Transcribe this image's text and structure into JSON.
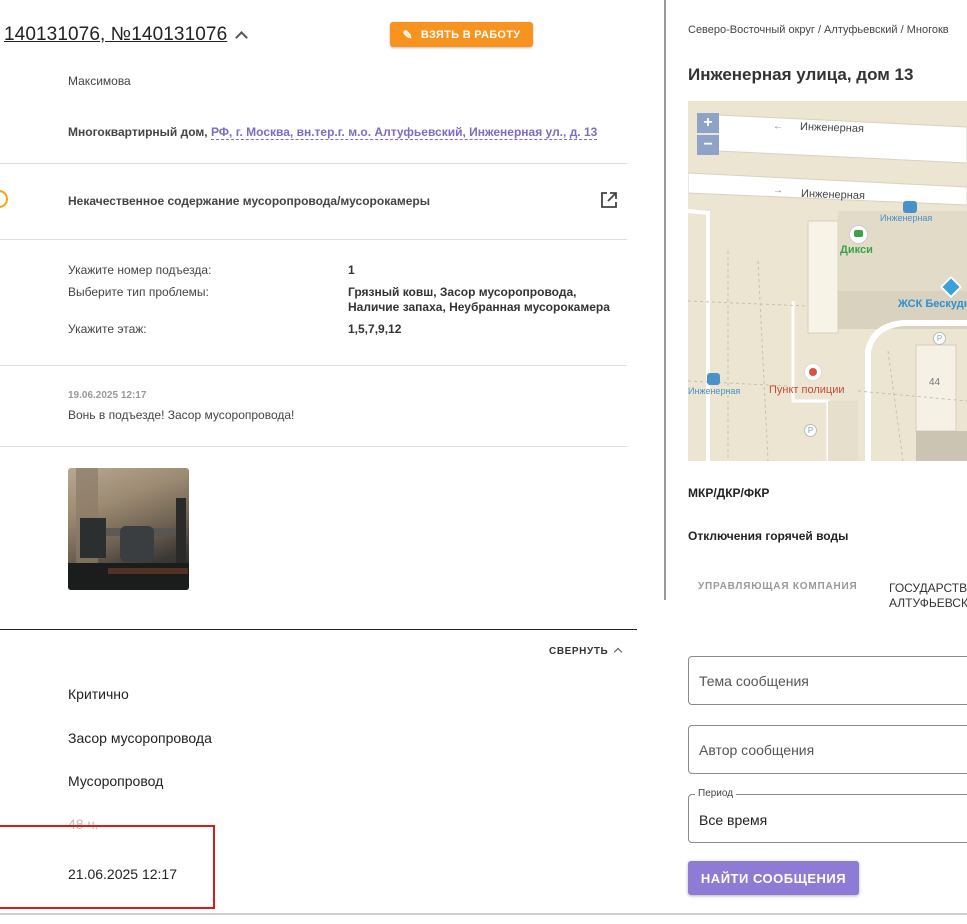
{
  "ticket": {
    "title": "140131076, №140131076",
    "take_button": "ВЗЯТЬ В РАБОТУ",
    "person": "Максимова",
    "building_prefix": "Многоквартирный дом,",
    "building_address": "РФ, г. Москва, вн.тер.г. м.о. Алтуфьевский, Инженерная ул., д. 13",
    "category": "Некачественное содержание мусоропровода/мусорокамеры",
    "details": [
      {
        "label": "Укажите номер подъезда:",
        "value": "1"
      },
      {
        "label": "Выберите тип проблемы:",
        "value": "Грязный ковш, Засор мусоропровода, Наличие запаха, Неубранная мусорокамера"
      },
      {
        "label": "Укажите этаж:",
        "value": "1,5,7,9,12"
      }
    ],
    "comment": {
      "timestamp": "19.06.2025 12:17",
      "text": "Вонь в подъезде! Засор мусоропровода!"
    },
    "collapse_label": "СВЕРНУТЬ",
    "fields": [
      "Критично",
      "Засор мусоропровода",
      "Мусоропровод",
      "48 ч.",
      "21.06.2025 12:17"
    ]
  },
  "side": {
    "breadcrumb": "Северо-Восточный округ / Алтуфьевский / Многокв",
    "address": "Инженерная улица, дом 13",
    "map": {
      "zoom_in": "+",
      "zoom_out": "−",
      "labels": {
        "street_top": "Инженерная",
        "street_mid": "Инженерная",
        "stop_right": "Инженерная",
        "stop_left": "Инженерная",
        "shop": "Дикси",
        "hoa": "ЖСК Бескудн",
        "police": "Пункт полиции",
        "house": "44",
        "parking1": "P",
        "parking2": "P"
      }
    },
    "mkr_label": "МКР/ДКР/ФКР",
    "hot_water_label": "Отключения горячей воды",
    "uk_label": "УПРАВЛЯЮЩАЯ КОМПАНИЯ",
    "uk_value": "ГОСУДАРСТВ АЛТУФЬЕВСК",
    "subject_placeholder": "Тема сообщения",
    "author_placeholder": "Автор сообщения",
    "period_label": "Период",
    "period_value": "Все время",
    "find_button": "НАЙТИ СООБЩЕНИЯ"
  },
  "colors": {
    "accent_orange": "#f7931e",
    "accent_purple": "#8e7bd6",
    "link_purple": "#7e6bc4",
    "highlight_red": "#d41c1c"
  }
}
